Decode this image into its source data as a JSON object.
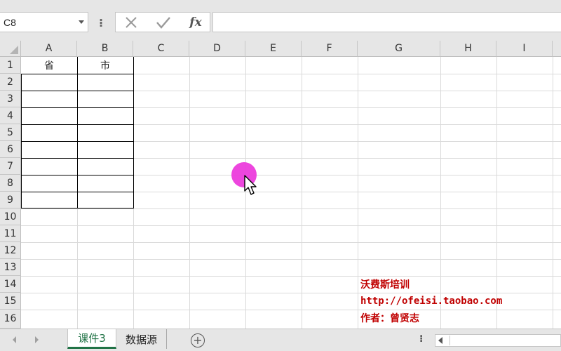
{
  "formula_bar": {
    "name_box": "C8",
    "more_glyph": "⁝",
    "cancel_glyph": "✕",
    "enter_glyph": "✓",
    "fx_label": "fx",
    "formula_value": ""
  },
  "columns": [
    "A",
    "B",
    "C",
    "D",
    "E",
    "F",
    "G",
    "H",
    "I"
  ],
  "rows": [
    "1",
    "2",
    "3",
    "4",
    "5",
    "6",
    "7",
    "8",
    "9",
    "10",
    "11",
    "12",
    "13",
    "14",
    "15",
    "16"
  ],
  "cells": {
    "A1": "省",
    "B1": "市"
  },
  "credits": {
    "line1": "沃费斯培训",
    "line2": "http://ofeisi.taobao.com",
    "line3": "作者：曾贤志"
  },
  "tabs": [
    {
      "label": "课件3",
      "active": true
    },
    {
      "label": "数据源",
      "active": false
    }
  ],
  "tabbar": {
    "add_glyph": "+",
    "more_glyph": "⁝"
  },
  "colors": {
    "accent": "#217346",
    "credit_text": "#c00000",
    "click_highlight": "#ec3cdc"
  },
  "icons": {
    "cursor": "arrow-cursor-icon",
    "add": "plus-circle-icon"
  }
}
